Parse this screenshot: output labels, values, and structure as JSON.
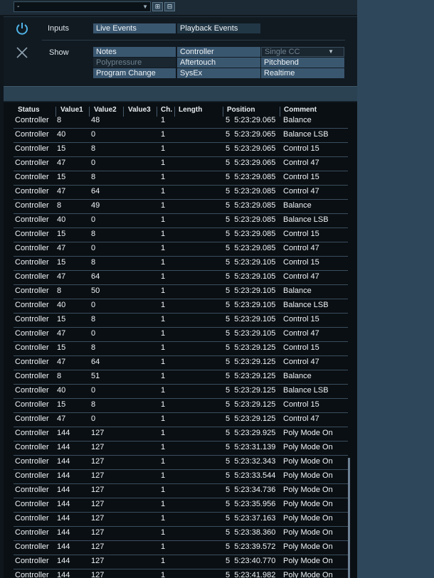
{
  "topbar": {
    "preset_value": "-",
    "icons": [
      "add-preset-icon",
      "save-preset-icon"
    ]
  },
  "filter": {
    "inputs_label": "Inputs",
    "show_label": "Show",
    "inputs": [
      {
        "label": "Live Events",
        "active": true
      },
      {
        "label": "Playback Events",
        "active": false
      }
    ],
    "show": {
      "notes": "Notes",
      "controller": "Controller",
      "single_cc": "Single CC",
      "polypressure": "Polypressure",
      "aftertouch": "Aftertouch",
      "pitchbend": "Pitchbend",
      "program_change": "Program Change",
      "sysex": "SysEx",
      "realtime": "Realtime"
    }
  },
  "table": {
    "columns": [
      "Status",
      "Value1",
      "Value2",
      "Value3",
      "Ch.",
      "Length",
      "Position",
      "Comment"
    ],
    "rows": [
      [
        "Controller",
        "8",
        "48",
        "",
        "1",
        "",
        "5  5:23:29.065",
        "Balance"
      ],
      [
        "Controller",
        "40",
        "0",
        "",
        "1",
        "",
        "5  5:23:29.065",
        "Balance LSB"
      ],
      [
        "Controller",
        "15",
        "8",
        "",
        "1",
        "",
        "5  5:23:29.065",
        "Control 15"
      ],
      [
        "Controller",
        "47",
        "0",
        "",
        "1",
        "",
        "5  5:23:29.065",
        "Control 47"
      ],
      [
        "Controller",
        "15",
        "8",
        "",
        "1",
        "",
        "5  5:23:29.085",
        "Control 15"
      ],
      [
        "Controller",
        "47",
        "64",
        "",
        "1",
        "",
        "5  5:23:29.085",
        "Control 47"
      ],
      [
        "Controller",
        "8",
        "49",
        "",
        "1",
        "",
        "5  5:23:29.085",
        "Balance"
      ],
      [
        "Controller",
        "40",
        "0",
        "",
        "1",
        "",
        "5  5:23:29.085",
        "Balance LSB"
      ],
      [
        "Controller",
        "15",
        "8",
        "",
        "1",
        "",
        "5  5:23:29.085",
        "Control 15"
      ],
      [
        "Controller",
        "47",
        "0",
        "",
        "1",
        "",
        "5  5:23:29.085",
        "Control 47"
      ],
      [
        "Controller",
        "15",
        "8",
        "",
        "1",
        "",
        "5  5:23:29.105",
        "Control 15"
      ],
      [
        "Controller",
        "47",
        "64",
        "",
        "1",
        "",
        "5  5:23:29.105",
        "Control 47"
      ],
      [
        "Controller",
        "8",
        "50",
        "",
        "1",
        "",
        "5  5:23:29.105",
        "Balance"
      ],
      [
        "Controller",
        "40",
        "0",
        "",
        "1",
        "",
        "5  5:23:29.105",
        "Balance LSB"
      ],
      [
        "Controller",
        "15",
        "8",
        "",
        "1",
        "",
        "5  5:23:29.105",
        "Control 15"
      ],
      [
        "Controller",
        "47",
        "0",
        "",
        "1",
        "",
        "5  5:23:29.105",
        "Control 47"
      ],
      [
        "Controller",
        "15",
        "8",
        "",
        "1",
        "",
        "5  5:23:29.125",
        "Control 15"
      ],
      [
        "Controller",
        "47",
        "64",
        "",
        "1",
        "",
        "5  5:23:29.125",
        "Control 47"
      ],
      [
        "Controller",
        "8",
        "51",
        "",
        "1",
        "",
        "5  5:23:29.125",
        "Balance"
      ],
      [
        "Controller",
        "40",
        "0",
        "",
        "1",
        "",
        "5  5:23:29.125",
        "Balance LSB"
      ],
      [
        "Controller",
        "15",
        "8",
        "",
        "1",
        "",
        "5  5:23:29.125",
        "Control 15"
      ],
      [
        "Controller",
        "47",
        "0",
        "",
        "1",
        "",
        "5  5:23:29.125",
        "Control 47"
      ],
      [
        "Controller",
        "144",
        "127",
        "",
        "1",
        "",
        "5  5:23:29.925",
        "Poly Mode On"
      ],
      [
        "Controller",
        "144",
        "127",
        "",
        "1",
        "",
        "5  5:23:31.139",
        "Poly Mode On"
      ],
      [
        "Controller",
        "144",
        "127",
        "",
        "1",
        "",
        "5  5:23:32.343",
        "Poly Mode On"
      ],
      [
        "Controller",
        "144",
        "127",
        "",
        "1",
        "",
        "5  5:23:33.544",
        "Poly Mode On"
      ],
      [
        "Controller",
        "144",
        "127",
        "",
        "1",
        "",
        "5  5:23:34.736",
        "Poly Mode On"
      ],
      [
        "Controller",
        "144",
        "127",
        "",
        "1",
        "",
        "5  5:23:35.956",
        "Poly Mode On"
      ],
      [
        "Controller",
        "144",
        "127",
        "",
        "1",
        "",
        "5  5:23:37.163",
        "Poly Mode On"
      ],
      [
        "Controller",
        "144",
        "127",
        "",
        "1",
        "",
        "5  5:23:38.360",
        "Poly Mode On"
      ],
      [
        "Controller",
        "144",
        "127",
        "",
        "1",
        "",
        "5  5:23:39.572",
        "Poly Mode On"
      ],
      [
        "Controller",
        "144",
        "127",
        "",
        "1",
        "",
        "5  5:23:40.770",
        "Poly Mode On"
      ],
      [
        "Controller",
        "144",
        "127",
        "",
        "1",
        "",
        "5  5:23:41.982",
        "Poly Mode On"
      ]
    ]
  }
}
